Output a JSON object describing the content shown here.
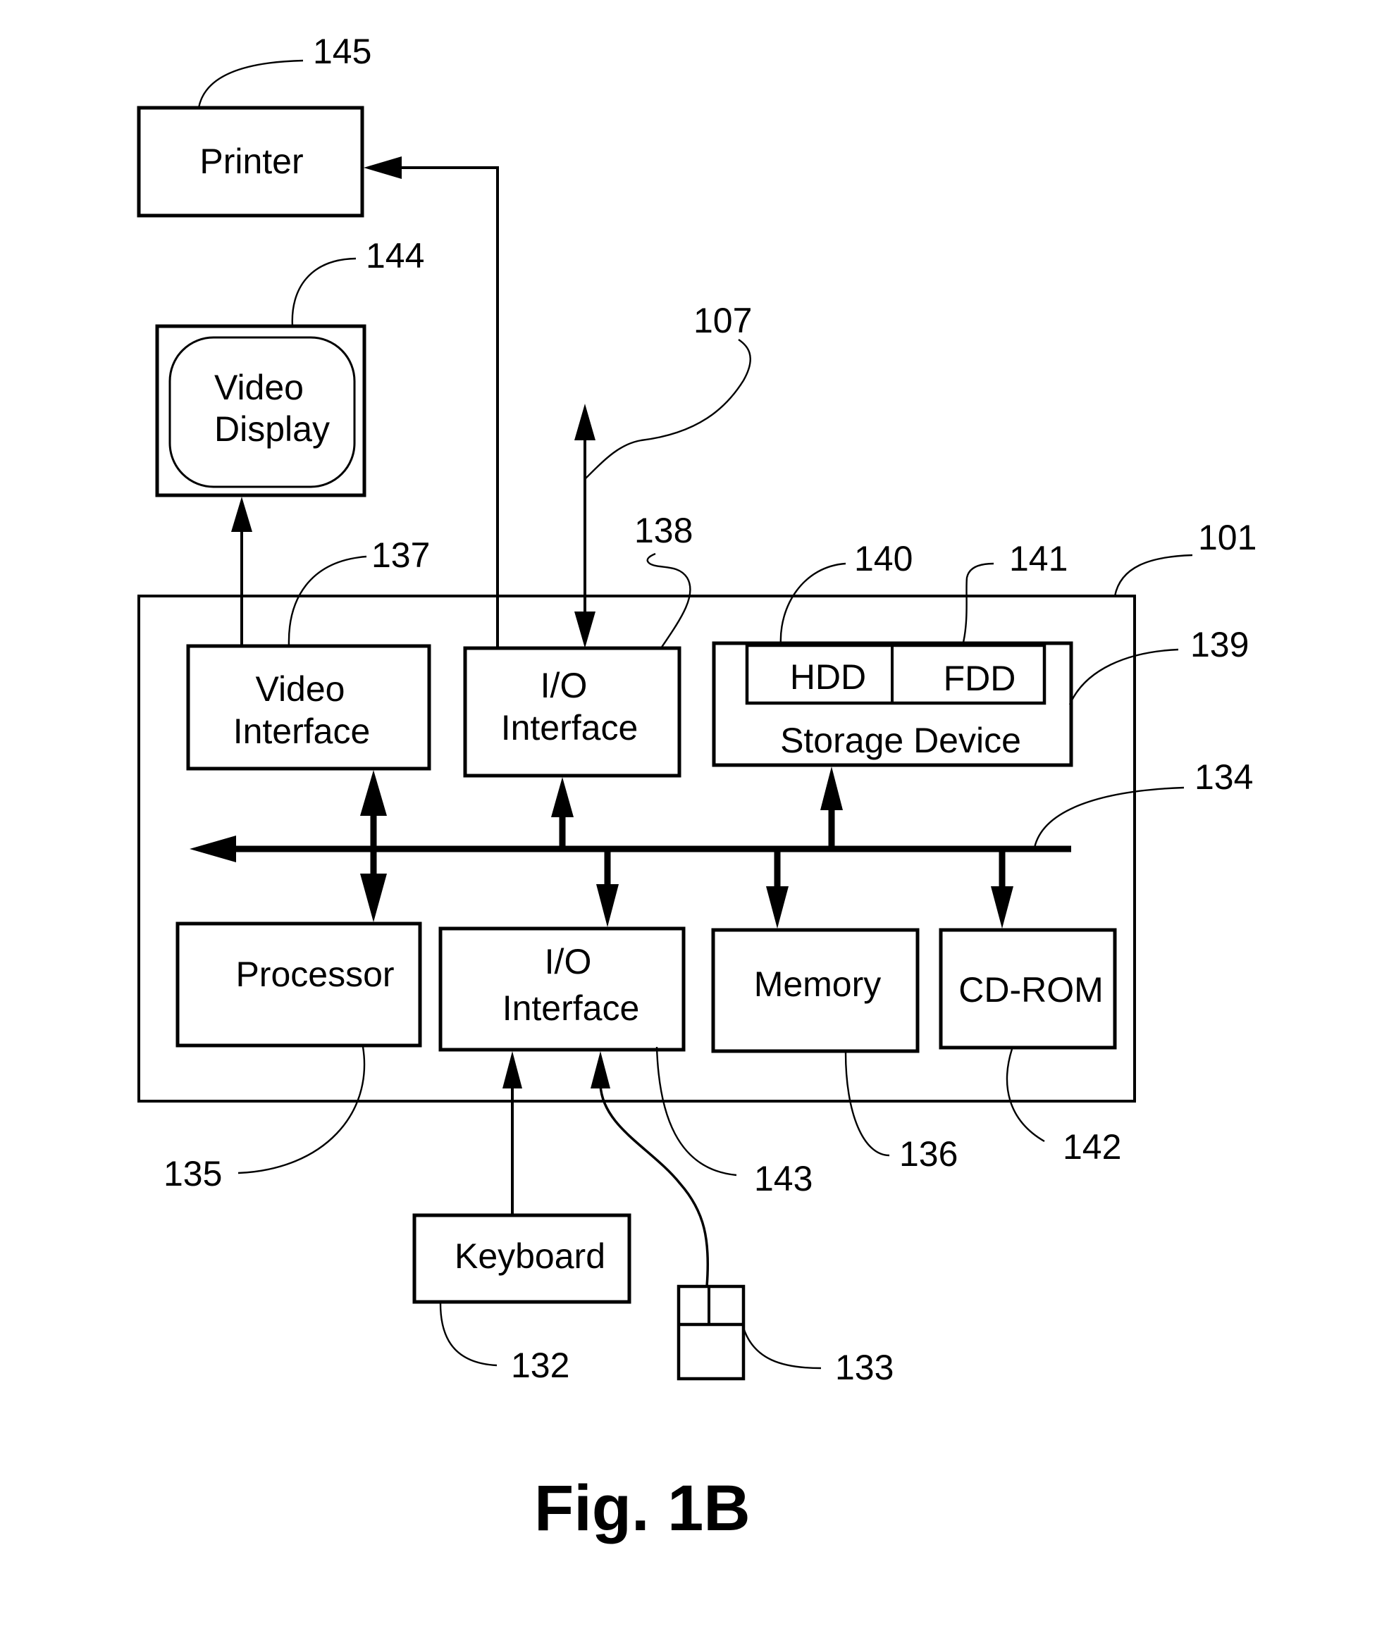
{
  "figure": {
    "caption": "Fig. 1B"
  },
  "components": {
    "printer": {
      "label": "Printer",
      "ref": "145"
    },
    "video_display": {
      "line1": "Video",
      "line2": "Display",
      "ref": "144"
    },
    "network": {
      "ref": "107"
    },
    "computer": {
      "ref": "101"
    },
    "video_interface": {
      "line1": "Video",
      "line2": "Interface",
      "ref": "137"
    },
    "io_interface_top": {
      "line1": "I/O",
      "line2": "Interface",
      "ref": "138"
    },
    "storage_device": {
      "label": "Storage Device",
      "ref": "139"
    },
    "hdd": {
      "label": "HDD",
      "ref": "140"
    },
    "fdd": {
      "label": "FDD",
      "ref": "141"
    },
    "bus": {
      "ref": "134"
    },
    "processor": {
      "label": "Processor",
      "ref": "135"
    },
    "io_interface_bottom": {
      "line1": "I/O",
      "line2": "Interface",
      "ref": "143"
    },
    "memory": {
      "label": "Memory",
      "ref": "136"
    },
    "cdrom": {
      "label": "CD-ROM",
      "ref": "142"
    },
    "keyboard": {
      "label": "Keyboard",
      "ref": "132"
    },
    "mouse": {
      "ref": "133"
    }
  }
}
